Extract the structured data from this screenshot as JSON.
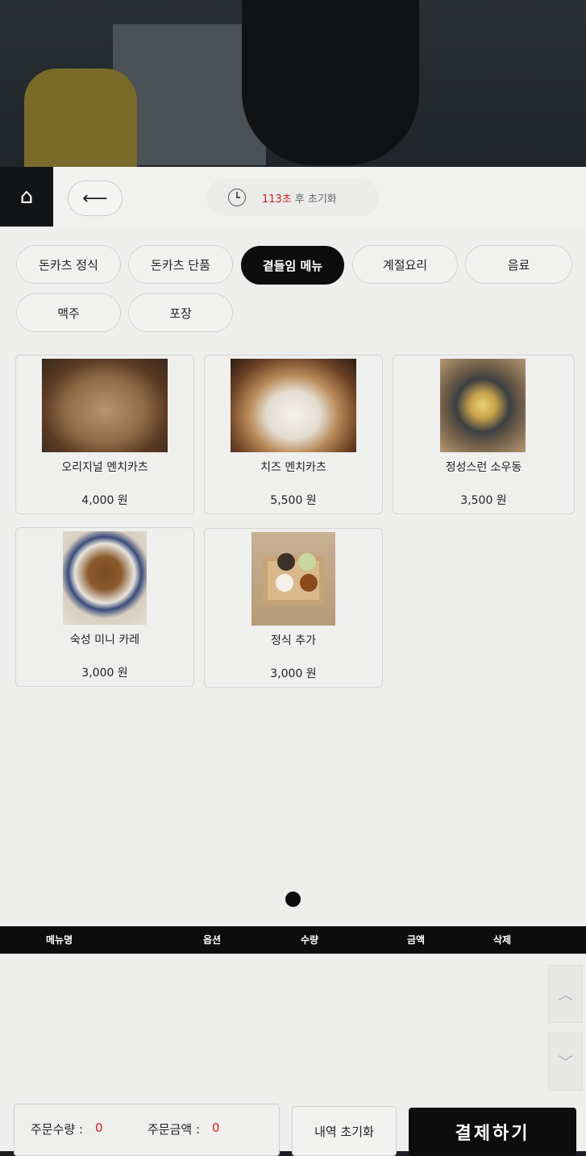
{
  "header": {
    "timer_seconds": "113초",
    "timer_suffix": "후 초기화",
    "back_arrow": "⟵",
    "home_icon": "⌂"
  },
  "categories": [
    {
      "label": "돈카츠 정식",
      "active": false
    },
    {
      "label": "돈카츠 단품",
      "active": false
    },
    {
      "label": "곁들임 메뉴",
      "active": true
    },
    {
      "label": "계절요리",
      "active": false
    },
    {
      "label": "음료",
      "active": false
    },
    {
      "label": "맥주",
      "active": false
    },
    {
      "label": "포장",
      "active": false
    }
  ],
  "menu_items": [
    {
      "name": "오리지널 멘치카츠",
      "price": "4,000 원"
    },
    {
      "name": "치즈 멘치카츠",
      "price": "5,500 원"
    },
    {
      "name": "정성스런 소우동",
      "price": "3,500 원"
    },
    {
      "name": "숙성 미니 카레",
      "price": "3,000 원"
    },
    {
      "name": "정식 추가",
      "price": "3,000 원"
    }
  ],
  "order_table": {
    "headers": [
      "메뉴명",
      "옵션",
      "수량",
      "금액",
      "삭제"
    ]
  },
  "summary": {
    "quantity_label": "주문수량 :",
    "quantity_value": "0",
    "amount_label": "주문금액 :",
    "amount_value": "0"
  },
  "buttons": {
    "reset": "내역 초기화",
    "pay": "결제하기",
    "scroll_up": "︿",
    "scroll_down": "﹀"
  },
  "colors": {
    "accent_red": "#d02020",
    "active_tab": "#0d0d0d",
    "screen_bg": "#eeeeed"
  }
}
